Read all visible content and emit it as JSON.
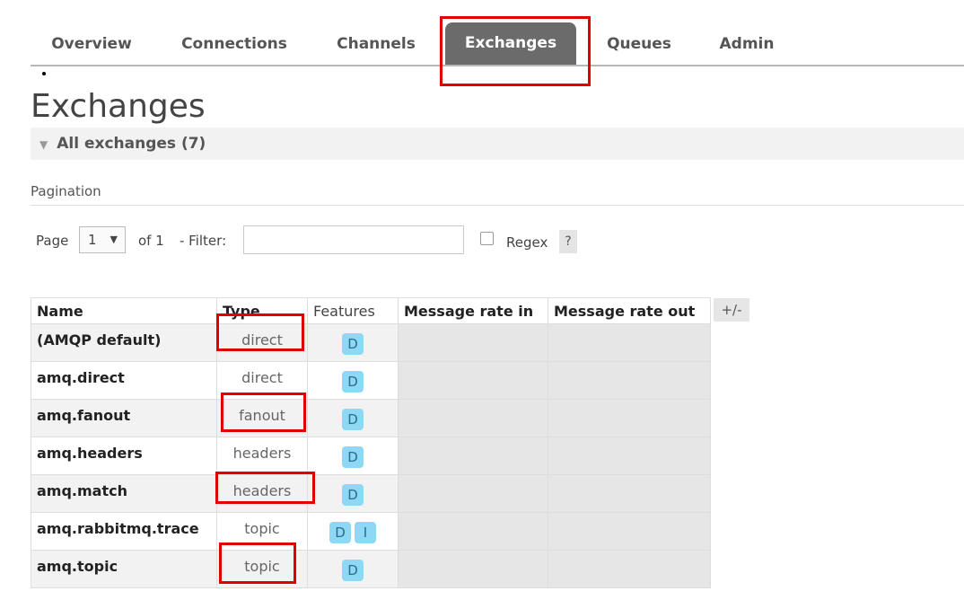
{
  "nav": {
    "tabs": [
      "Overview",
      "Connections",
      "Channels",
      "Exchanges",
      "Queues",
      "Admin"
    ],
    "active": "Exchanges"
  },
  "page_title": "Exchanges",
  "section": {
    "label": "All exchanges (7)"
  },
  "pagination": {
    "label": "Pagination",
    "page_label": "Page",
    "page_value": "1",
    "of_label": "of 1",
    "filter_label": "- Filter:",
    "filter_value": "",
    "regex_label": "Regex",
    "help_label": "?"
  },
  "table": {
    "headers": [
      "Name",
      "Type",
      "Features",
      "Message rate in",
      "Message rate out"
    ],
    "toggle_label": "+/-",
    "rows": [
      {
        "name": "(AMQP default)",
        "type": "direct",
        "features": [
          "D"
        ],
        "rate_in": "",
        "rate_out": ""
      },
      {
        "name": "amq.direct",
        "type": "direct",
        "features": [
          "D"
        ],
        "rate_in": "",
        "rate_out": ""
      },
      {
        "name": "amq.fanout",
        "type": "fanout",
        "features": [
          "D"
        ],
        "rate_in": "",
        "rate_out": ""
      },
      {
        "name": "amq.headers",
        "type": "headers",
        "features": [
          "D"
        ],
        "rate_in": "",
        "rate_out": ""
      },
      {
        "name": "amq.match",
        "type": "headers",
        "features": [
          "D"
        ],
        "rate_in": "",
        "rate_out": ""
      },
      {
        "name": "amq.rabbitmq.trace",
        "type": "topic",
        "features": [
          "D",
          "I"
        ],
        "rate_in": "",
        "rate_out": ""
      },
      {
        "name": "amq.topic",
        "type": "topic",
        "features": [
          "D"
        ],
        "rate_in": "",
        "rate_out": ""
      }
    ]
  },
  "colors": {
    "highlight": "#e00000",
    "badge": "#8ed8f5",
    "active_tab": "#6b6b6b"
  }
}
